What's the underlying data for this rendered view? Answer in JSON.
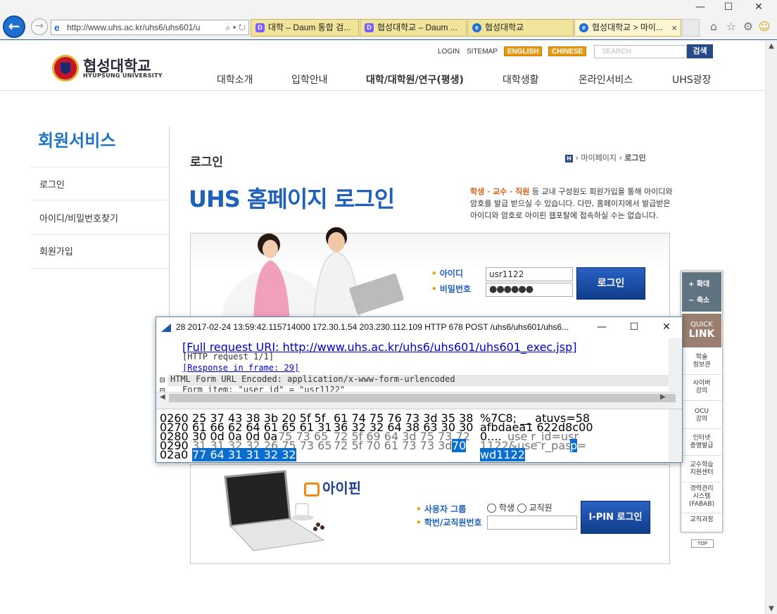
{
  "browser": {
    "url": "http://www.uhs.ac.kr/uhs6/uhs601/u",
    "addr_tools": "⌕ ▾ ↻",
    "tabs": [
      {
        "label": "대학 – Daum 통합 검..."
      },
      {
        "label": "협성대학교 – Daum ..."
      },
      {
        "label": "협성대학교"
      },
      {
        "label": "협성대학교 > 마이..."
      }
    ],
    "tab_close": "×",
    "colors": {
      "accent": "#1e6fd0",
      "tab_bg": "#f0e49a"
    }
  },
  "site": {
    "logo_ko": "협성대학교",
    "logo_en": "HYUPSUNG UNIVERSITY",
    "util": {
      "login": "LOGIN",
      "sitemap": "SITEMAP",
      "english": "ENGLISH",
      "chinese": "CHINESE"
    },
    "search_placeholder": "SEARCH",
    "search_button": "검색",
    "gnb": [
      "대학소개",
      "입학안내",
      "대학/대학원/연구(평생)",
      "대학생활",
      "온라인서비스",
      "UHS광장"
    ]
  },
  "lnb": {
    "title": "회원서비스",
    "items": [
      "로그인",
      "아이디/비밀번호찾기",
      "회원가입"
    ]
  },
  "content": {
    "title": "로그인",
    "breadcrumb": {
      "home": "H",
      "items": [
        "마이페이지",
        "로그인"
      ]
    },
    "headline": "UHS 홈페이지 로그인",
    "desc_highlight": "학생 · 교수 · 직원",
    "desc_rest": " 등 교내 구성원도 회원가입을 통해 아이디와 암호를 발급 받으실 수 있습니다. 다만, 홈페이지에서 발급받은 아이디와 암호로 아이핀 웹포탈에 접속하실 수는 없습니다.",
    "login": {
      "id_label": "아이디",
      "pw_label": "비밀번호",
      "id_value": "usr1122",
      "pw_value": "●●●●●●",
      "button": "로그인"
    },
    "ipin": {
      "logo": "아이핀",
      "group_label": "사용자 그룹",
      "id_label": "학번/교직원번호",
      "options": [
        "학생",
        "교직원"
      ],
      "button": "I-PIN 로그인"
    }
  },
  "quick": {
    "zoom_in": "+  확대",
    "zoom_out": "−  축소",
    "quick": "QUICK",
    "link": "LINK",
    "items": [
      "학술\n정보관",
      "사이버\n강의",
      "OCU\n강의",
      "인터넷\n증명발급",
      "교수학습\n지원센터",
      "경력관리\n시스템\n(FABAB)",
      "교직과정"
    ],
    "top": "TOP"
  },
  "wireshark": {
    "title": "28 2017-02-24 13:59:42.115714000 172.30.1.54 203.230.112.109 HTTP 678 POST /uhs6/uhs601/uhs6...",
    "tree": [
      "[Full request URI: http://www.uhs.ac.kr/uhs6/uhs601/uhs601_exec.jsp]",
      "[HTTP request 1/1]",
      "[Response in frame: 29]",
      "HTML Form URL Encoded: application/x-www-form-urlencoded",
      "Form item: \"user_id\" = \"usr1122\""
    ],
    "hex": [
      {
        "off": "0260",
        "a": "25 37 43 38 3b 20 5f 5f",
        "b": "61 74 75 76 73 3d 35 38",
        "asc": "%7C8; __ atuvs=58"
      },
      {
        "off": "0270",
        "a": "61 66 62 64 61 65 61 31",
        "b": "36 32 32 64 38 63 30 30",
        "asc": "afbdaea1 622d8c00"
      },
      {
        "off": "0280",
        "a": "30 0d 0a 0d 0a",
        "a_dim": "75 73 65",
        "b": "72 5f 69 64 3d 75 73 72",
        "asc": "0....",
        "asc_dim": "use r_id=usr"
      },
      {
        "off": "0290",
        "a": "31 31 32 32 26 75 73 65",
        "b": "72 5f 70 61 73 73 3d",
        "b_sel": "70",
        "asc": "1122&use r_pass=",
        "asc_sel": "p"
      },
      {
        "off": "02a0",
        "a_sel": "77 64 31 31 32 32",
        "asc_sel": "wd1122"
      }
    ]
  }
}
